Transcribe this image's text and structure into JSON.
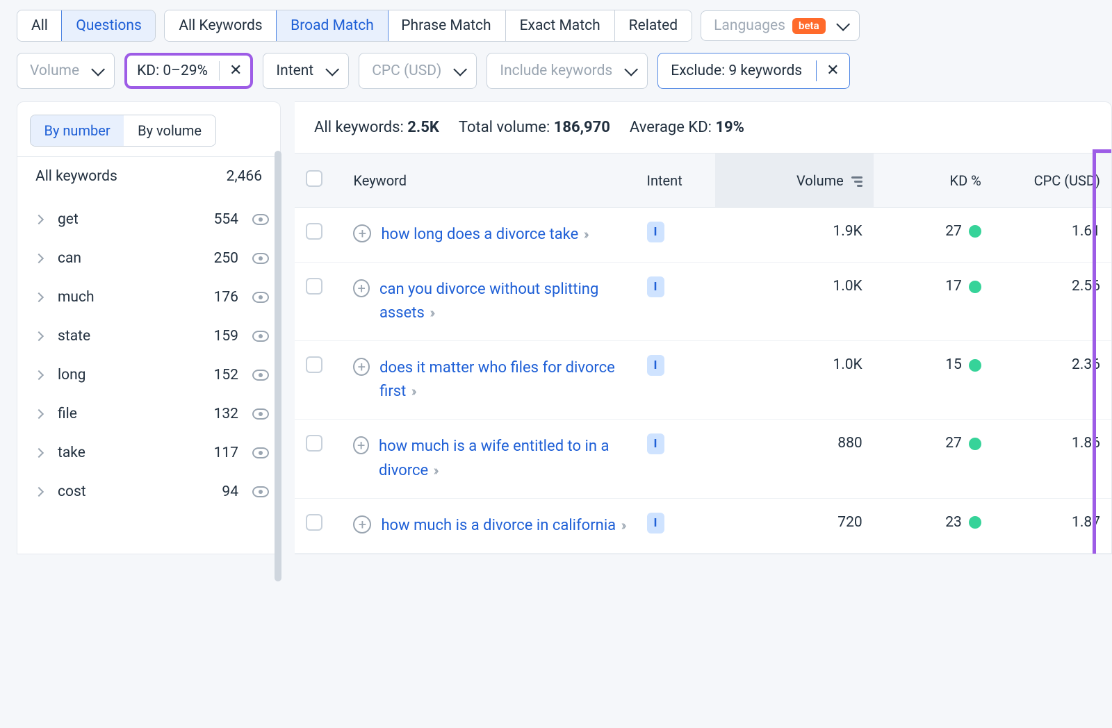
{
  "top_tabs": {
    "group1": [
      "All",
      "Questions"
    ],
    "group1_active": 1,
    "group2": [
      "All Keywords",
      "Broad Match",
      "Phrase Match",
      "Exact Match",
      "Related"
    ],
    "group2_active": 1,
    "languages_label": "Languages",
    "beta": "beta"
  },
  "filters": {
    "volume": "Volume",
    "kd": "KD: 0–29%",
    "intent": "Intent",
    "cpc": "CPC (USD)",
    "include": "Include keywords",
    "exclude": "Exclude: 9 keywords"
  },
  "sidebar": {
    "toggle": [
      "By number",
      "By volume"
    ],
    "toggle_active": 0,
    "all_label": "All keywords",
    "all_count": "2,466",
    "items": [
      {
        "term": "get",
        "count": "554"
      },
      {
        "term": "can",
        "count": "250"
      },
      {
        "term": "much",
        "count": "176"
      },
      {
        "term": "state",
        "count": "159"
      },
      {
        "term": "long",
        "count": "152"
      },
      {
        "term": "file",
        "count": "132"
      },
      {
        "term": "take",
        "count": "117"
      },
      {
        "term": "cost",
        "count": "94"
      }
    ]
  },
  "summary": {
    "all_kw_label": "All keywords:",
    "all_kw_value": "2.5K",
    "total_vol_label": "Total volume:",
    "total_vol_value": "186,970",
    "avg_kd_label": "Average KD:",
    "avg_kd_value": "19%"
  },
  "columns": {
    "keyword": "Keyword",
    "intent": "Intent",
    "volume": "Volume",
    "kd": "KD %",
    "cpc": "CPC (USD)"
  },
  "rows": [
    {
      "keyword": "how long does a divorce take",
      "intent": "I",
      "volume": "1.9K",
      "kd": "27",
      "cpc": "1.61"
    },
    {
      "keyword": "can you divorce without splitting assets",
      "intent": "I",
      "volume": "1.0K",
      "kd": "17",
      "cpc": "2.56"
    },
    {
      "keyword": "does it matter who files for divorce first",
      "intent": "I",
      "volume": "1.0K",
      "kd": "15",
      "cpc": "2.36"
    },
    {
      "keyword": "how much is a wife entitled to in a divorce",
      "intent": "I",
      "volume": "880",
      "kd": "27",
      "cpc": "1.86"
    },
    {
      "keyword": "how much is a divorce in california",
      "intent": "I",
      "volume": "720",
      "kd": "23",
      "cpc": "1.87"
    }
  ]
}
